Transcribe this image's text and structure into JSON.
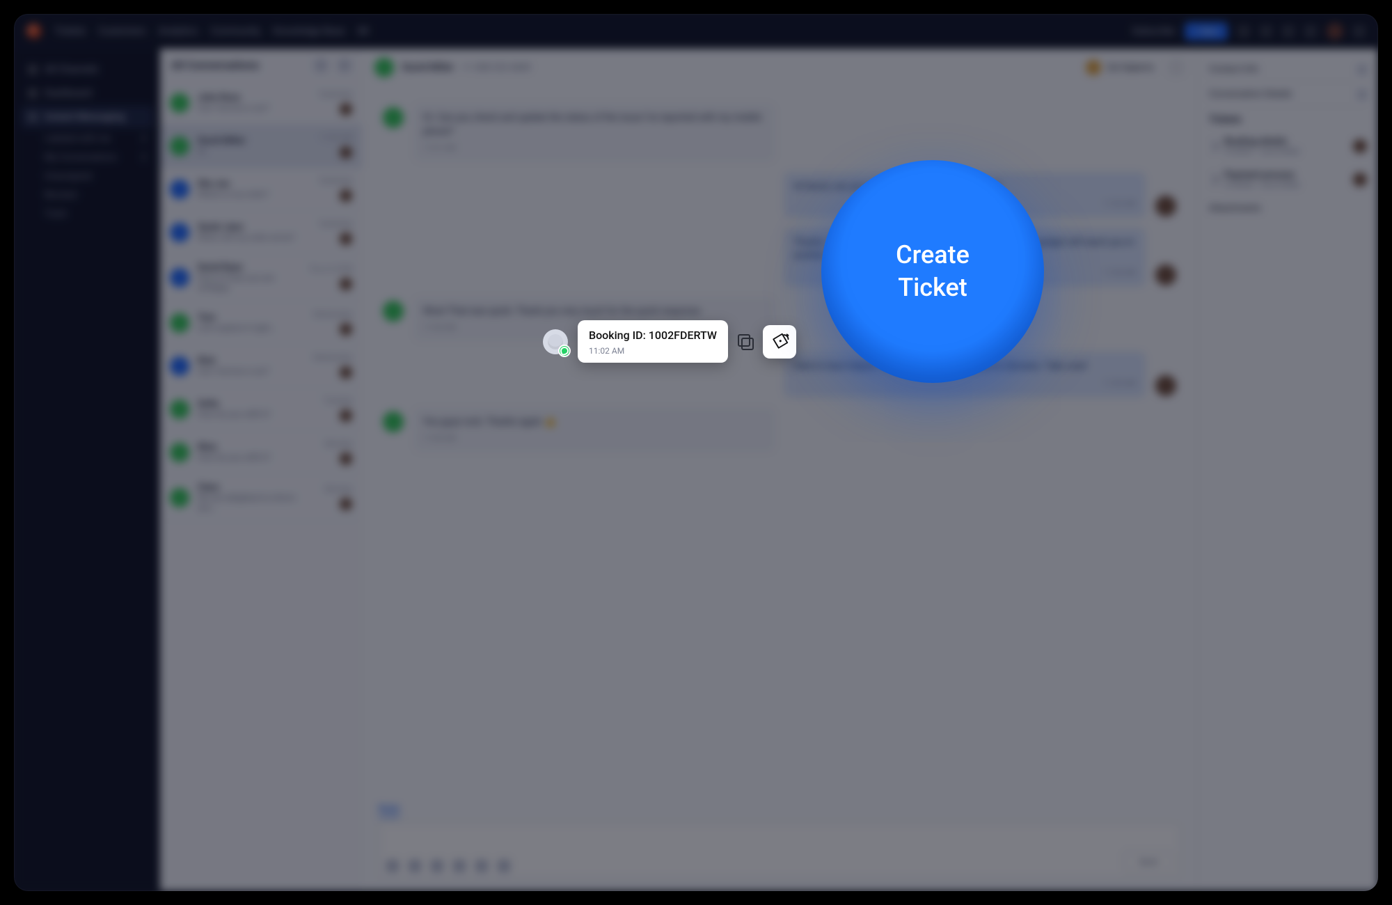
{
  "topbar": {
    "links": [
      "Tickets",
      "Customers",
      "Analytics",
      "Community",
      "Knowledge Base",
      "IM"
    ],
    "trial": "Subscribe",
    "new_btn": "+ New"
  },
  "sidebar": {
    "all_channels": "All Channels",
    "dashboard": "Dashboard",
    "im_label": "Instant Messaging",
    "subs": [
      "Labeled with me",
      "My Conversations",
      "Unassigned",
      "Blocked",
      "Trash"
    ],
    "counts": [
      "2",
      "2"
    ]
  },
  "convo_list": {
    "title": "All Conversations",
    "items": [
      {
        "name": "John Ross",
        "sub": "Can I borrow a car?",
        "time": "Yesterday",
        "avatar": "g"
      },
      {
        "name": "David Miller",
        "sub": "Hi",
        "time": "11:02 AM",
        "avatar": "g"
      },
      {
        "name": "Ella Joe",
        "sub": "Where is my order?",
        "time": "Yesterday",
        "avatar": "b"
      },
      {
        "name": "Sarah Jane",
        "sub": "When will my order arrive?",
        "time": "Yesterday",
        "avatar": "b"
      },
      {
        "name": "David Ryan",
        "sub": "Sorry to hear you are unhappy",
        "time": "Thu 6:14 PM",
        "avatar": "b"
      },
      {
        "name": "Tom",
        "sub": "Let's explore it right…",
        "time": "Wednesday",
        "avatar": "g"
      },
      {
        "name": "Rick",
        "sub": "Can I borrow a car?",
        "time": "Wednesday",
        "avatar": "b"
      },
      {
        "name": "Sofia",
        "sub": "How do you refill it?",
        "time": "Tuesday",
        "avatar": "g"
      },
      {
        "name": "Nina",
        "sub": "How do you refill it?",
        "time": "Monday",
        "avatar": "g"
      },
      {
        "name": "Clara",
        "sub": "We are delighted to inform you…",
        "time": "Monday",
        "avatar": "g"
      }
    ]
  },
  "chat": {
    "name": "David Miller",
    "phone": "+1 408-332-4689",
    "assignee": "Zal Sejkerts",
    "messages": [
      {
        "dir": "in",
        "text": "Hi. Can you check and update the status of the issue I've reported with my mobile phone?",
        "time": "11:01 AM"
      },
      {
        "dir": "out",
        "text": "Hi David, can you confirm your booking ID for me?",
        "time": "11:02 AM"
      },
      {
        "dir": "out",
        "text": "Thanks. I could see that the issue has been fixed and your gadget will reach you in another 48 hours.",
        "time": "11:04 AM"
      },
      {
        "dir": "in",
        "text": "Wow! That was quick. Thank you very much for the quick response.",
        "time": "11:04 AM"
      },
      {
        "dir": "out",
        "text": "Glad to have helped. Thank you for reaching out to Zylcares. Take care!",
        "time": "11:05 AM"
      },
      {
        "dir": "in",
        "text": "You guys rock. Thanks again 👍",
        "time": "11:06 AM"
      }
    ],
    "reply_tab": "Reply",
    "send": "Send"
  },
  "details": {
    "contact_info": "Contact Info",
    "conv_details": "Conversation Details",
    "tickets_h": "Tickets",
    "tickets": [
      {
        "title": "Booking details",
        "sub": "#100001 · David Miller"
      },
      {
        "title": "Payment process",
        "sub": "#100002 · David Miller"
      }
    ],
    "attachments": "Attachments"
  },
  "focus": {
    "message_text": "Booking ID: 1002FDERTW",
    "message_time": "11:02 AM",
    "coach_text": "Create Ticket"
  }
}
